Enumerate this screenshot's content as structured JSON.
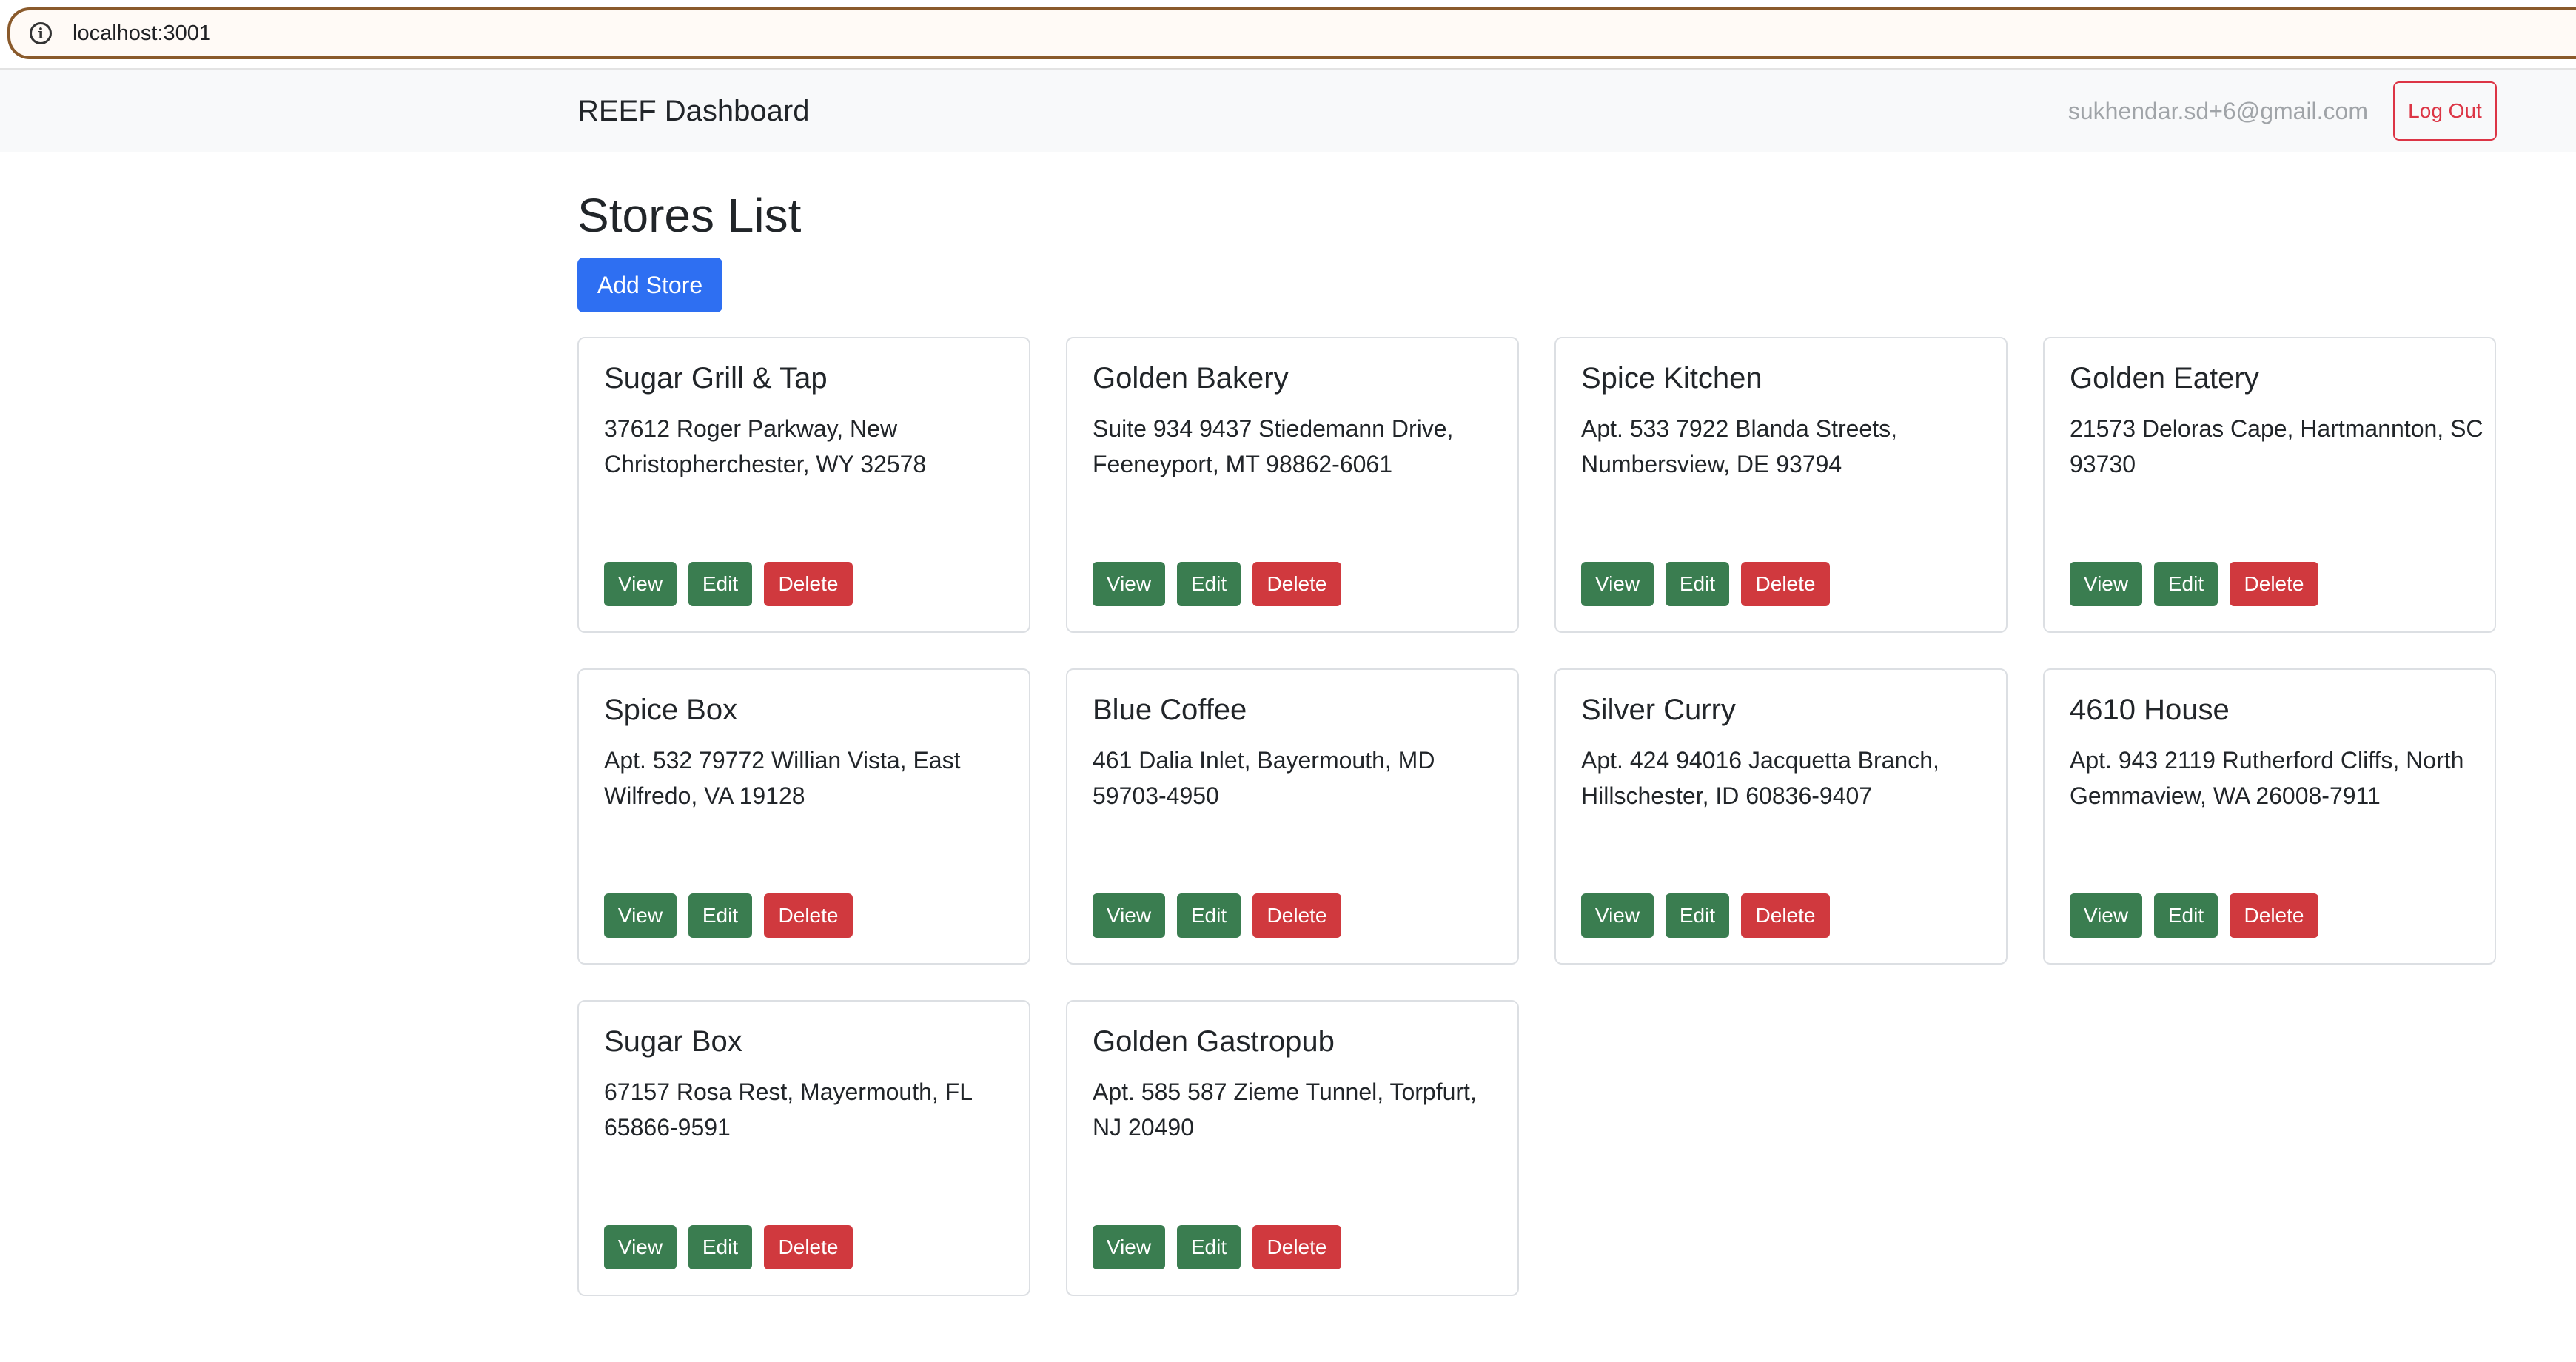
{
  "browser": {
    "url": "localhost:3001",
    "info_icon": "info-icon"
  },
  "navbar": {
    "brand": "REEF Dashboard",
    "user_email": "sukhendar.sd+6@gmail.com",
    "logout_label": "Log Out"
  },
  "main": {
    "title": "Stores List",
    "add_store_label": "Add Store",
    "actions": {
      "view_label": "View",
      "edit_label": "Edit",
      "delete_label": "Delete"
    },
    "stores": [
      {
        "name": "Sugar Grill & Tap",
        "address": "37612 Roger Parkway, New Christopherchester, WY 32578"
      },
      {
        "name": "Golden Bakery",
        "address": "Suite 934 9437 Stiedemann Drive, Feeneyport, MT 98862-6061"
      },
      {
        "name": "Spice Kitchen",
        "address": "Apt. 533 7922 Blanda Streets, Numbersview, DE 93794"
      },
      {
        "name": "Golden Eatery",
        "address": "21573 Deloras Cape, Hartmannton, SC 93730"
      },
      {
        "name": "Spice Box",
        "address": "Apt. 532 79772 Willian Vista, East Wilfredo, VA 19128"
      },
      {
        "name": "Blue Coffee",
        "address": "461 Dalia Inlet, Bayermouth, MD 59703-4950"
      },
      {
        "name": "Silver Curry",
        "address": "Apt. 424 94016 Jacquetta Branch, Hillschester, ID 60836-9407"
      },
      {
        "name": "4610 House",
        "address": "Apt. 943 2119 Rutherford Cliffs, North Gemmaview, WA 26008-7911"
      },
      {
        "name": "Sugar Box",
        "address": "67157 Rosa Rest, Mayermouth, FL 65866-9591"
      },
      {
        "name": "Golden Gastropub",
        "address": "Apt. 585 587 Zieme Tunnel, Torpfurt, NJ 20490"
      }
    ]
  },
  "colors": {
    "primary": "#2e6ff2",
    "success": "#3a7d50",
    "danger": "#d0393e",
    "navbar_bg": "#f8f9fa"
  }
}
